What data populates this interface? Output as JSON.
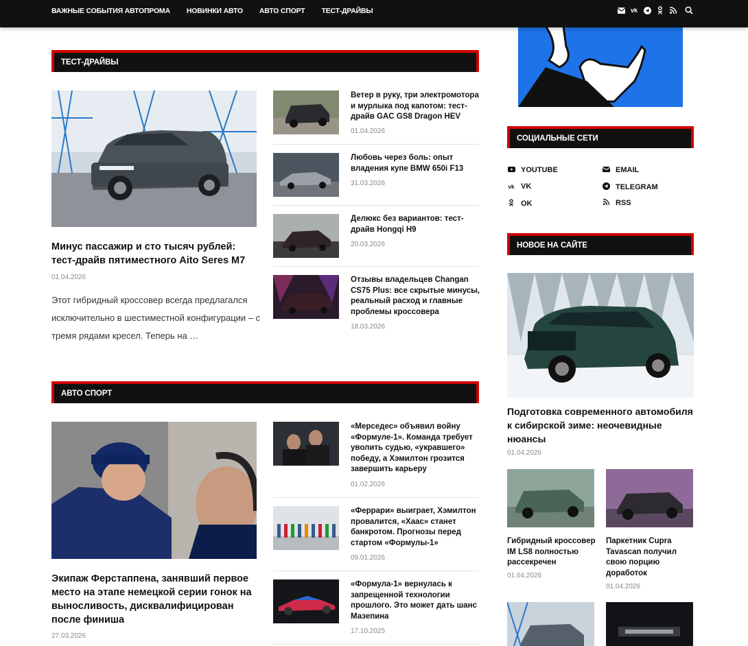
{
  "nav": {
    "items": [
      "ВАЖНЫЕ СОБЫТИЯ АВТОПРОМА",
      "НОВИНКИ АВТО",
      "АВТО СПОРТ",
      "ТЕСТ-ДРАЙВЫ"
    ],
    "icons": [
      "email-icon",
      "vk-icon",
      "telegram-icon",
      "ok-icon",
      "rss-icon",
      "search-icon"
    ]
  },
  "test_drives": {
    "heading": "ТЕСТ-ДРАЙВЫ",
    "featured": {
      "title": "Минус пассажир и сто тысяч рублей: тест-драйв пятиместного Aito Seres M7",
      "date": "01.04.2026",
      "excerpt": "Этот гибридный кроссовер всегда предлагался исключительно в шестиместной конфигурации – с тремя рядами кресел. Теперь на …"
    },
    "items": [
      {
        "title": "Ветер в руку, три электромотора и мурлыка под капотом: тест-драйв GAC GS8 Dragon HEV",
        "date": "01.04.2026"
      },
      {
        "title": "Любовь через боль: опыт владения купе BMW 650i F13",
        "date": "31.03.2026"
      },
      {
        "title": "Делюкс без вариантов: тест-драйв Hongqi H9",
        "date": "20.03.2026"
      },
      {
        "title": "Отзывы владельцев Changan CS75 Plus: все скрытые минусы, реальный расход и главные проблемы кроссовера",
        "date": "18.03.2026"
      }
    ]
  },
  "motorsport": {
    "heading": "АВТО СПОРТ",
    "featured": {
      "title": "Экипаж Ферстаппена, занявший первое место на этапе немецкой серии гонок на выносливость, дисквалифицирован после финиша",
      "date": "27.03.2026"
    },
    "items": [
      {
        "title": "«Мерседес» объявил войну «Формуле-1». Команда требует уволить судью, «укравшего» победу, а Хэмилтон грозится завершить карьеру",
        "date": "01.02.2026"
      },
      {
        "title": "«Феррари» выиграет, Хэмилтон провалится, «Хаас» станет банкротом. Прогнозы перед стартом «Формулы-1»",
        "date": "09.01.2026"
      },
      {
        "title": "«Формула-1» вернулась к запрещенной технологии прошлого. Это может дать шанс Мазепина",
        "date": "17.10.2025"
      }
    ]
  },
  "sidebar": {
    "social_heading": "СОЦИАЛЬНЫЕ СЕТИ",
    "social": [
      {
        "label": "YOUTUBE",
        "icon": "youtube-icon"
      },
      {
        "label": "EMAIL",
        "icon": "email-icon"
      },
      {
        "label": "VK",
        "icon": "vk-icon"
      },
      {
        "label": "TELEGRAM",
        "icon": "telegram-icon"
      },
      {
        "label": "OK",
        "icon": "ok-icon"
      },
      {
        "label": "RSS",
        "icon": "rss-icon"
      }
    ],
    "new_heading": "НОВОЕ НА САЙТЕ",
    "featured": {
      "title": "Подготовка современного автомобиля к сибирской зиме: неочевидные нюансы",
      "date": "01.04.2026"
    },
    "grid": [
      {
        "title": "Гибридный кроссовер IM LS8 полностью рассекречен",
        "date": "01.04.2026"
      },
      {
        "title": "Паркетник Cupra Tavascan получил свою порцию доработок",
        "date": "01.04.2026"
      }
    ]
  },
  "colors": {
    "accent": "#d10000",
    "bar": "#111111"
  }
}
